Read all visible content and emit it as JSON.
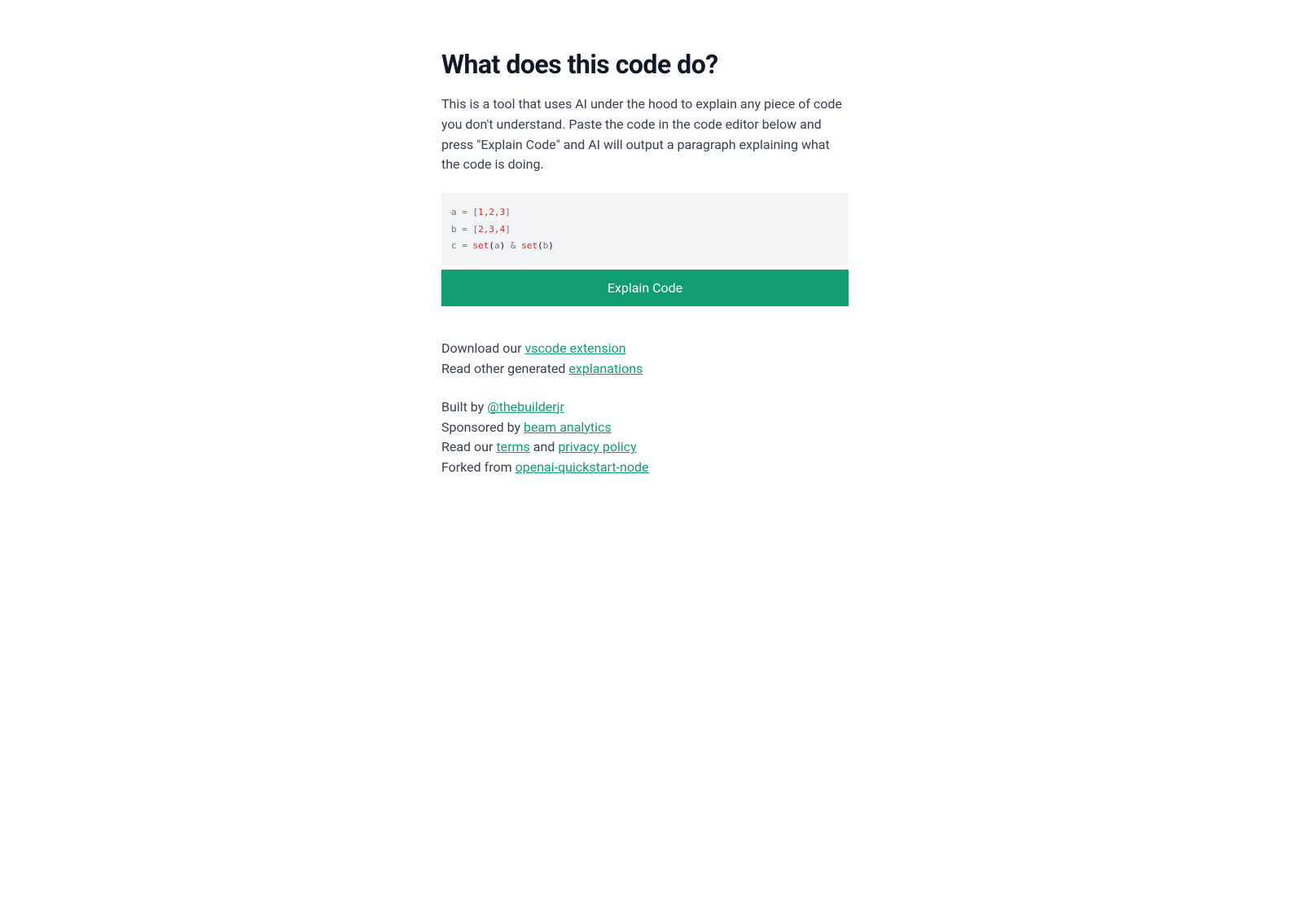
{
  "heading": "What does this code do?",
  "description": "This is a tool that uses AI under the hood to explain any piece of code you don't understand. Paste the code in the code editor below and press \"Explain Code\" and AI will output a paragraph explaining what the code is doing.",
  "code": {
    "line1_a": "a = [",
    "line1_nums": "1,2,3",
    "line1_b": "]",
    "line2_a": "b = [",
    "line2_nums": "2,3,4",
    "line2_b": "]",
    "line3_a": "c = ",
    "line3_fn1": "set",
    "line3_p1": "(",
    "line3_arg1": "a",
    "line3_p2": ")",
    "line3_amp": " & ",
    "line3_fn2": "set",
    "line3_p3": "(",
    "line3_arg2": "b",
    "line3_p4": ")"
  },
  "button": "Explain Code",
  "links": {
    "download_prefix": "Download our ",
    "vscode_extension": "vscode extension",
    "read_other_prefix": "Read other generated ",
    "explanations": "explanations",
    "built_by_prefix": "Built by ",
    "builder": "@thebuilderjr",
    "sponsored_prefix": "Sponsored by ",
    "sponsor": "beam analytics",
    "read_our_prefix": "Read our ",
    "terms": "terms",
    "and": " and ",
    "privacy": "privacy policy",
    "forked_prefix": "Forked from ",
    "forked": "openai-quickstart-node"
  }
}
